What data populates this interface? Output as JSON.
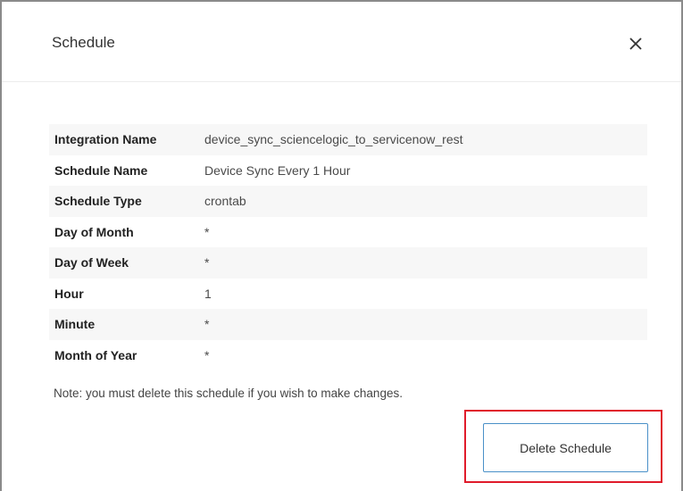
{
  "dialog": {
    "title": "Schedule",
    "close_icon": "close-icon"
  },
  "details": [
    {
      "label": "Integration Name",
      "value": "device_sync_sciencelogic_to_servicenow_rest"
    },
    {
      "label": "Schedule Name",
      "value": "Device Sync Every 1 Hour"
    },
    {
      "label": "Schedule Type",
      "value": "crontab"
    },
    {
      "label": "Day of Month",
      "value": "*"
    },
    {
      "label": "Day of Week",
      "value": "*"
    },
    {
      "label": "Hour",
      "value": "1"
    },
    {
      "label": "Minute",
      "value": "*"
    },
    {
      "label": "Month of Year",
      "value": "*"
    }
  ],
  "note": "Note: you must delete this schedule if you wish to make changes.",
  "actions": {
    "delete_label": "Delete Schedule"
  },
  "colors": {
    "highlight": "#e01b2b",
    "button_border": "#4a90c8"
  }
}
